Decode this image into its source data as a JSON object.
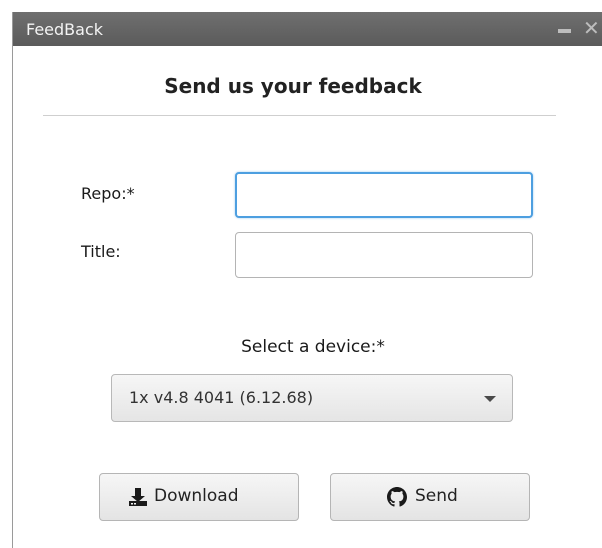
{
  "window": {
    "title": "FeedBack",
    "close_glyph": "✕"
  },
  "form": {
    "heading": "Send us your feedback",
    "repo_label": "Repo:*",
    "repo_value": "",
    "title_label": "Title:",
    "title_value": "",
    "device_label": "Select a device:*",
    "device_selected": "1x v4.8 4041 (6.12.68)"
  },
  "actions": {
    "download_label": "Download",
    "download_icon": "download-icon",
    "send_label": "Send",
    "send_icon": "github-icon"
  },
  "colors": {
    "titlebar": "#5f5f5f",
    "focus_border": "#4d9fe0",
    "button_bg": "#ececec"
  }
}
